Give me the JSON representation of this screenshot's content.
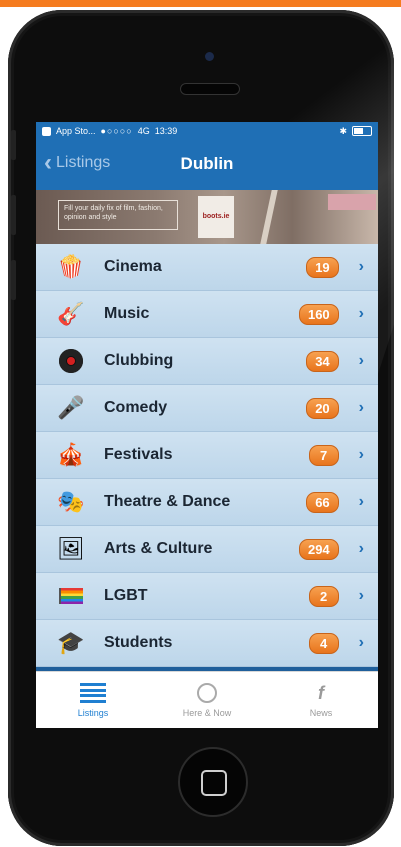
{
  "status_bar": {
    "carrier": "App Sto...",
    "signal": "●○○○○",
    "network": "4G",
    "time": "13:39"
  },
  "nav": {
    "back_label": "Listings",
    "title": "Dublin"
  },
  "banner": {
    "text": "Fill your daily fix of film, fashion, opinion and style",
    "logo": "boots.ie"
  },
  "categories": [
    {
      "label": "Cinema",
      "count": "19",
      "icon": "popcorn-icon",
      "glyph": "🍿"
    },
    {
      "label": "Music",
      "count": "160",
      "icon": "guitar-icon",
      "glyph": "🎸"
    },
    {
      "label": "Clubbing",
      "count": "34",
      "icon": "record-icon",
      "glyph": "⏺"
    },
    {
      "label": "Comedy",
      "count": "20",
      "icon": "microphone-icon",
      "glyph": "🎤"
    },
    {
      "label": "Festivals",
      "count": "7",
      "icon": "circus-tent-icon",
      "glyph": "🎪"
    },
    {
      "label": "Theatre & Dance",
      "count": "66",
      "icon": "theatre-masks-icon",
      "glyph": "🎭"
    },
    {
      "label": "Arts & Culture",
      "count": "294",
      "icon": "picture-icon",
      "glyph": "🖼"
    },
    {
      "label": "LGBT",
      "count": "2",
      "icon": "rainbow-flag-icon",
      "glyph": "🏳"
    },
    {
      "label": "Students",
      "count": "4",
      "icon": "graduation-cap-icon",
      "glyph": "🎓"
    }
  ],
  "tabs": [
    {
      "label": "Listings",
      "icon": "list-icon",
      "active": true
    },
    {
      "label": "Here & Now",
      "icon": "globe-icon",
      "active": false
    },
    {
      "label": "News",
      "icon": "news-icon",
      "active": false
    }
  ],
  "colors": {
    "nav_blue": "#1f6fb5",
    "badge_orange": "#e8741c",
    "row_blue": "#cfe2f1",
    "tab_active": "#1f7fd1"
  }
}
